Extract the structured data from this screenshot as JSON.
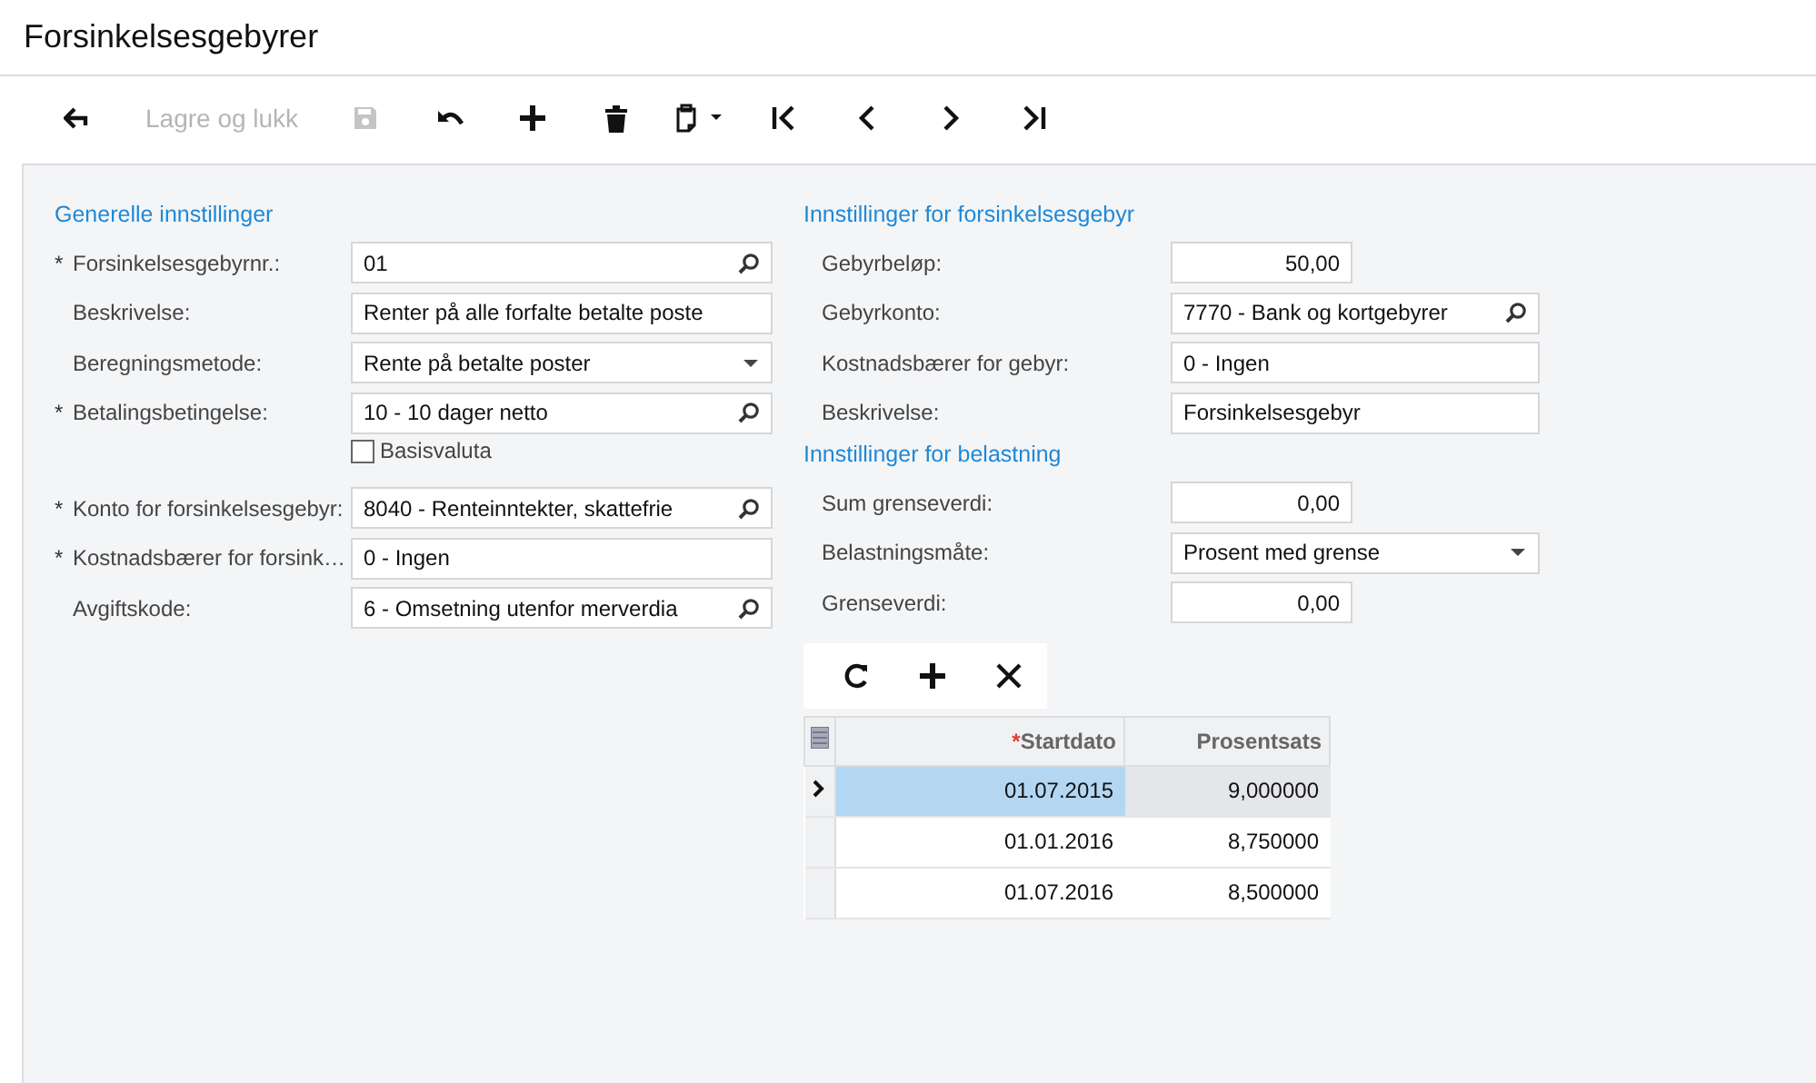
{
  "window": {
    "title": "Forsinkelsesgebyrer"
  },
  "toolbar": {
    "save_and_close": {
      "label": "Lagre og lukk",
      "disabled": true
    },
    "save": {
      "disabled": true
    }
  },
  "general": {
    "heading": "Generelle innstillinger",
    "fields": [
      {
        "label": "Forsinkelsesgebyrnr.:",
        "required_mark": "*",
        "kind": "lookup",
        "value": "01"
      },
      {
        "label": "Beskrivelse:",
        "kind": "text",
        "value": "Renter på alle forfalte betalte poste"
      },
      {
        "label": "Beregningsmetode:",
        "kind": "select",
        "value": "Rente på betalte poster"
      },
      {
        "label": "Betalingsbetingelse:",
        "required_mark": "*",
        "kind": "lookup",
        "value": "10 - 10 dager netto"
      },
      {
        "label": "Basisvaluta",
        "kind": "checkbox",
        "checked": false
      },
      {
        "label": "Konto for forsinkelsesgebyr:",
        "required_mark": "*",
        "kind": "lookup",
        "value": "8040 - Renteinntekter, skattefrie"
      },
      {
        "label": "Kostnadsbærer for forsink…",
        "required_mark": "*",
        "kind": "text",
        "value": "0 - Ingen"
      },
      {
        "label": "Avgiftskode:",
        "kind": "lookup",
        "value": "6 - Omsetning utenfor merverdia"
      }
    ]
  },
  "fee_settings": {
    "heading": "Innstillinger for forsinkelsesgebyr",
    "fields": [
      {
        "label": "Gebyrbeløp:",
        "kind": "number",
        "value": "50,00"
      },
      {
        "label": "Gebyrkonto:",
        "kind": "lookup",
        "value": "7770 - Bank og kortgebyrer"
      },
      {
        "label": "Kostnadsbærer for gebyr:",
        "kind": "text",
        "value": "0 - Ingen"
      },
      {
        "label": "Beskrivelse:",
        "kind": "text",
        "value": "Forsinkelsesgebyr"
      }
    ]
  },
  "charge_settings": {
    "heading": "Innstillinger for belastning",
    "fields": [
      {
        "label": "Sum grenseverdi:",
        "kind": "number",
        "value": "0,00"
      },
      {
        "label": "Belastningsmåte:",
        "kind": "select",
        "value": "Prosent med grense"
      },
      {
        "label": "Grenseverdi:",
        "kind": "number",
        "value": "0,00"
      }
    ]
  },
  "grid": {
    "columns": [
      {
        "label": "Startdato",
        "required_mark": "*"
      },
      {
        "label": "Prosentsats"
      }
    ],
    "rows": [
      {
        "selected": true,
        "cells": [
          "01.07.2015",
          "9,000000"
        ]
      },
      {
        "selected": false,
        "cells": [
          "01.01.2016",
          "8,750000"
        ]
      },
      {
        "selected": false,
        "cells": [
          "01.07.2016",
          "8,500000"
        ]
      }
    ]
  }
}
